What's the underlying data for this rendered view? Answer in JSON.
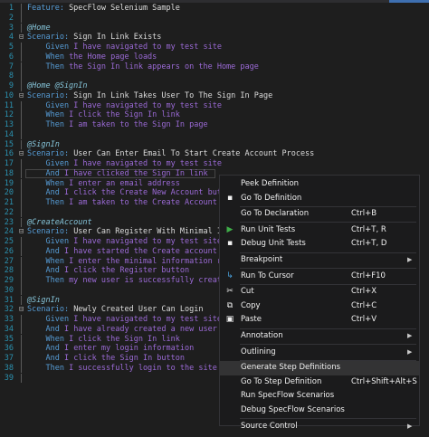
{
  "editor": {
    "lines": [
      {
        "n": "1",
        "fold": "",
        "parts": [
          {
            "c": "kw",
            "t": "Feature: "
          },
          {
            "c": "txt",
            "t": "SpecFlow Selenium Sample"
          }
        ]
      },
      {
        "n": "2",
        "fold": "",
        "parts": []
      },
      {
        "n": "3",
        "fold": "",
        "parts": [
          {
            "c": "tag",
            "t": "@Home"
          }
        ]
      },
      {
        "n": "4",
        "fold": "⊟",
        "parts": [
          {
            "c": "kw",
            "t": "Scenario: "
          },
          {
            "c": "txt",
            "t": "Sign In Link Exists"
          }
        ]
      },
      {
        "n": "5",
        "fold": "",
        "parts": [
          {
            "c": "kw",
            "t": "    Given "
          },
          {
            "c": "arg",
            "t": "I have navigated to my test site"
          }
        ]
      },
      {
        "n": "6",
        "fold": "",
        "parts": [
          {
            "c": "kw",
            "t": "    When "
          },
          {
            "c": "arg",
            "t": "the Home page loads"
          }
        ]
      },
      {
        "n": "7",
        "fold": "",
        "parts": [
          {
            "c": "kw",
            "t": "    Then "
          },
          {
            "c": "arg",
            "t": "the Sign In link appears on the Home page"
          }
        ]
      },
      {
        "n": "8",
        "fold": "",
        "parts": []
      },
      {
        "n": "9",
        "fold": "",
        "parts": [
          {
            "c": "tag",
            "t": "@Home @SignIn"
          }
        ]
      },
      {
        "n": "10",
        "fold": "⊟",
        "parts": [
          {
            "c": "kw",
            "t": "Scenario: "
          },
          {
            "c": "txt",
            "t": "Sign In Link Takes User To The Sign In Page"
          }
        ]
      },
      {
        "n": "11",
        "fold": "",
        "parts": [
          {
            "c": "kw",
            "t": "    Given "
          },
          {
            "c": "arg",
            "t": "I have navigated to my test site"
          }
        ]
      },
      {
        "n": "12",
        "fold": "",
        "parts": [
          {
            "c": "kw",
            "t": "    When "
          },
          {
            "c": "arg",
            "t": "I click the Sign In link"
          }
        ]
      },
      {
        "n": "13",
        "fold": "",
        "parts": [
          {
            "c": "kw",
            "t": "    Then "
          },
          {
            "c": "arg",
            "t": "I am taken to the Sign In page"
          }
        ]
      },
      {
        "n": "14",
        "fold": "",
        "parts": []
      },
      {
        "n": "15",
        "fold": "",
        "parts": [
          {
            "c": "tag",
            "t": "@SignIn"
          }
        ]
      },
      {
        "n": "16",
        "fold": "⊟",
        "parts": [
          {
            "c": "kw",
            "t": "Scenario: "
          },
          {
            "c": "txt",
            "t": "User Can Enter Email To Start Create Account Process"
          }
        ]
      },
      {
        "n": "17",
        "fold": "",
        "parts": [
          {
            "c": "kw",
            "t": "    Given "
          },
          {
            "c": "arg",
            "t": "I have navigated to my test site"
          }
        ]
      },
      {
        "n": "18",
        "fold": "",
        "parts": [
          {
            "c": "kw",
            "t": "    And "
          },
          {
            "c": "arg",
            "t": "I have clicked the Sign In link"
          }
        ]
      },
      {
        "n": "19",
        "fold": "",
        "parts": [
          {
            "c": "kw",
            "t": "    When "
          },
          {
            "c": "arg",
            "t": "I enter an email address"
          }
        ]
      },
      {
        "n": "20",
        "fold": "",
        "parts": [
          {
            "c": "kw",
            "t": "    And "
          },
          {
            "c": "arg",
            "t": "I click the Create New Account button"
          }
        ]
      },
      {
        "n": "21",
        "fold": "",
        "parts": [
          {
            "c": "kw",
            "t": "    Then "
          },
          {
            "c": "arg",
            "t": "I am taken to the Create Account page"
          }
        ]
      },
      {
        "n": "22",
        "fold": "",
        "parts": []
      },
      {
        "n": "23",
        "fold": "",
        "parts": [
          {
            "c": "tag",
            "t": "@CreateAccount"
          }
        ]
      },
      {
        "n": "24",
        "fold": "⊟",
        "parts": [
          {
            "c": "kw",
            "t": "Scenario: "
          },
          {
            "c": "txt",
            "t": "User Can Register With Minimal Info"
          }
        ]
      },
      {
        "n": "25",
        "fold": "",
        "parts": [
          {
            "c": "kw",
            "t": "    Given "
          },
          {
            "c": "arg",
            "t": "I have navigated to my test site"
          }
        ]
      },
      {
        "n": "26",
        "fold": "",
        "parts": [
          {
            "c": "kw",
            "t": "    And "
          },
          {
            "c": "arg",
            "t": "I have started the Create account pro"
          }
        ]
      },
      {
        "n": "27",
        "fold": "",
        "parts": [
          {
            "c": "kw",
            "t": "    When "
          },
          {
            "c": "arg",
            "t": "I enter the minimal information requ"
          }
        ]
      },
      {
        "n": "28",
        "fold": "",
        "parts": [
          {
            "c": "kw",
            "t": "    And "
          },
          {
            "c": "arg",
            "t": "I click the Register button"
          }
        ]
      },
      {
        "n": "29",
        "fold": "",
        "parts": [
          {
            "c": "kw",
            "t": "    Then "
          },
          {
            "c": "arg",
            "t": "my new user is successfully created"
          }
        ]
      },
      {
        "n": "30",
        "fold": "",
        "parts": []
      },
      {
        "n": "31",
        "fold": "",
        "parts": [
          {
            "c": "tag",
            "t": "@SignIn"
          }
        ]
      },
      {
        "n": "32",
        "fold": "⊟",
        "parts": [
          {
            "c": "kw",
            "t": "Scenario: "
          },
          {
            "c": "txt",
            "t": "Newly Created User Can Login"
          }
        ]
      },
      {
        "n": "33",
        "fold": "",
        "parts": [
          {
            "c": "kw",
            "t": "    Given "
          },
          {
            "c": "arg",
            "t": "I have navigated to my test site"
          }
        ]
      },
      {
        "n": "34",
        "fold": "",
        "parts": [
          {
            "c": "kw",
            "t": "    And "
          },
          {
            "c": "arg",
            "t": "I have already created a new user"
          }
        ]
      },
      {
        "n": "35",
        "fold": "",
        "parts": [
          {
            "c": "kw",
            "t": "    When "
          },
          {
            "c": "arg",
            "t": "I click the Sign In link"
          }
        ]
      },
      {
        "n": "36",
        "fold": "",
        "parts": [
          {
            "c": "kw",
            "t": "    And "
          },
          {
            "c": "arg",
            "t": "I enter my login information"
          }
        ]
      },
      {
        "n": "37",
        "fold": "",
        "parts": [
          {
            "c": "kw",
            "t": "    And "
          },
          {
            "c": "arg",
            "t": "I click the Sign In button"
          }
        ]
      },
      {
        "n": "38",
        "fold": "",
        "parts": [
          {
            "c": "kw",
            "t": "    Then "
          },
          {
            "c": "arg",
            "t": "I successfully login to the site"
          }
        ]
      },
      {
        "n": "39",
        "fold": "",
        "parts": []
      }
    ],
    "current_line": 18
  },
  "context_menu": {
    "items": [
      {
        "type": "item",
        "label": "Peek Definition",
        "shortcut": "",
        "icon": "",
        "icon_name": "peek-definition-icon",
        "submenu": false
      },
      {
        "type": "item",
        "label": "Go To Definition",
        "shortcut": "",
        "icon": "▪",
        "icon_name": "go-to-definition-icon",
        "submenu": false
      },
      {
        "type": "sep"
      },
      {
        "type": "item",
        "label": "Go To Declaration",
        "shortcut": "Ctrl+B",
        "icon": "",
        "icon_name": "",
        "submenu": false
      },
      {
        "type": "sep"
      },
      {
        "type": "item",
        "label": "Run Unit Tests",
        "shortcut": "Ctrl+T, R",
        "icon": "▶",
        "icon_name": "run-tests-icon",
        "icon_color": "#3fae49",
        "submenu": false
      },
      {
        "type": "item",
        "label": "Debug Unit Tests",
        "shortcut": "Ctrl+T, D",
        "icon": "▪",
        "icon_name": "debug-tests-icon",
        "submenu": false
      },
      {
        "type": "sep"
      },
      {
        "type": "item",
        "label": "Breakpoint",
        "shortcut": "",
        "icon": "",
        "icon_name": "",
        "submenu": true
      },
      {
        "type": "sep"
      },
      {
        "type": "item",
        "label": "Run To Cursor",
        "shortcut": "Ctrl+F10",
        "icon": "↳",
        "icon_name": "run-to-cursor-icon",
        "icon_color": "#4aa3df",
        "submenu": false
      },
      {
        "type": "sep"
      },
      {
        "type": "item",
        "label": "Cut",
        "shortcut": "Ctrl+X",
        "icon": "✂",
        "icon_name": "cut-icon",
        "submenu": false
      },
      {
        "type": "item",
        "label": "Copy",
        "shortcut": "Ctrl+C",
        "icon": "⧉",
        "icon_name": "copy-icon",
        "submenu": false
      },
      {
        "type": "item",
        "label": "Paste",
        "shortcut": "Ctrl+V",
        "icon": "▣",
        "icon_name": "paste-icon",
        "submenu": false
      },
      {
        "type": "sep"
      },
      {
        "type": "item",
        "label": "Annotation",
        "shortcut": "",
        "icon": "",
        "icon_name": "",
        "submenu": true
      },
      {
        "type": "sep"
      },
      {
        "type": "item",
        "label": "Outlining",
        "shortcut": "",
        "icon": "",
        "icon_name": "",
        "submenu": true
      },
      {
        "type": "sep"
      },
      {
        "type": "item",
        "label": "Generate Step Definitions",
        "shortcut": "",
        "icon": "",
        "icon_name": "",
        "submenu": false,
        "selected": true
      },
      {
        "type": "item",
        "label": "Go To Step Definition",
        "shortcut": "Ctrl+Shift+Alt+S",
        "icon": "",
        "icon_name": "",
        "submenu": false
      },
      {
        "type": "item",
        "label": "Run SpecFlow Scenarios",
        "shortcut": "",
        "icon": "",
        "icon_name": "",
        "submenu": false
      },
      {
        "type": "item",
        "label": "Debug SpecFlow Scenarios",
        "shortcut": "",
        "icon": "",
        "icon_name": "",
        "submenu": false
      },
      {
        "type": "sep"
      },
      {
        "type": "item",
        "label": "Source Control",
        "shortcut": "",
        "icon": "",
        "icon_name": "",
        "submenu": true
      }
    ]
  },
  "colors": {
    "keyword": "#569cd6",
    "argument": "#9b6ad6",
    "tag": "#86c5da",
    "line_number": "#2b91af",
    "background": "#1e1e1e"
  }
}
